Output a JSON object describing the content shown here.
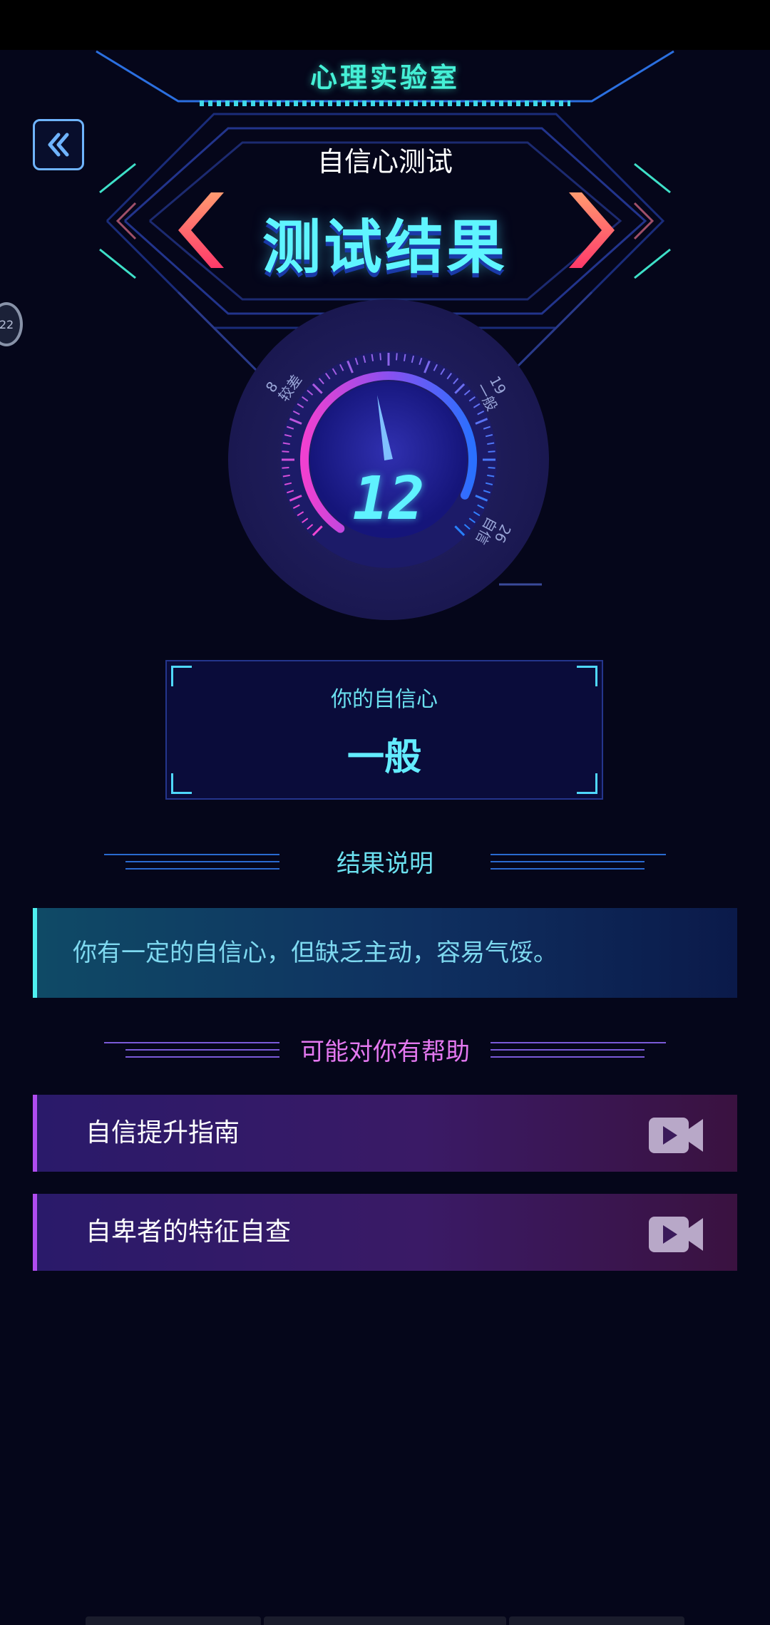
{
  "header": {
    "lab_title": "心理实验室",
    "subtitle": "自信心测试",
    "result_title": "测试结果",
    "back_icon": "double-chevron-left-icon"
  },
  "side_bubble": {
    "text": "22"
  },
  "gauge": {
    "value": "12",
    "min": 8,
    "max": 26,
    "labels": {
      "low_num": "8",
      "low_text": "较差",
      "mid_num": "19",
      "mid_text": "一般",
      "high_num": "26",
      "high_text": "自信"
    }
  },
  "result_card": {
    "label": "你的自信心",
    "value": "一般"
  },
  "explanation": {
    "title": "结果说明",
    "text": "你有一定的自信心，但缺乏主动，容易气馁。"
  },
  "help": {
    "title": "可能对你有帮助",
    "items": [
      {
        "label": "自信提升指南",
        "icon": "video-icon"
      },
      {
        "label": "自卑者的特征自查",
        "icon": "video-icon"
      }
    ]
  },
  "colors": {
    "background": "#05061a",
    "cyan": "#5ff2ff",
    "pink": "#e478f0",
    "purple": "#b04cf0"
  }
}
